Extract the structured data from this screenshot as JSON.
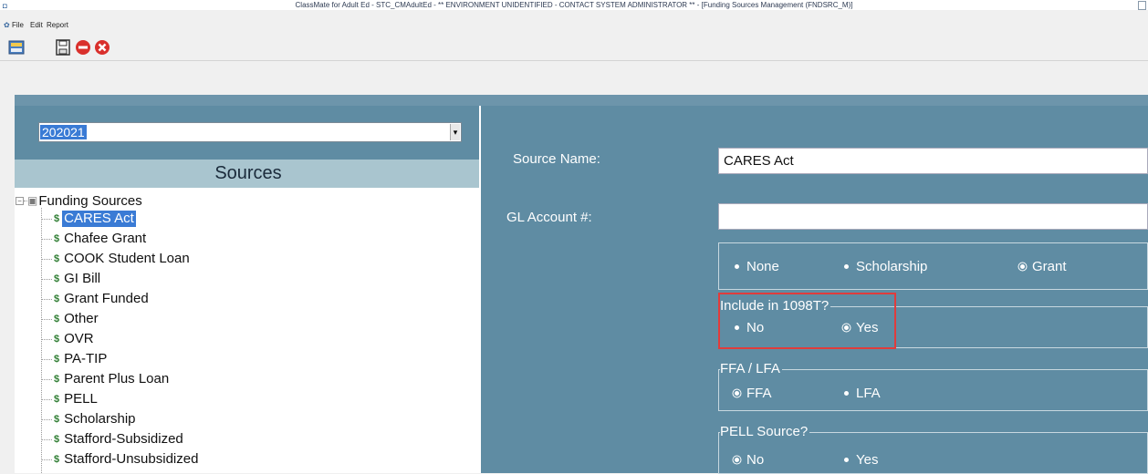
{
  "window": {
    "title": "ClassMate for Adult Ed - STC_CMAdultEd - ** ENVIRONMENT UNIDENTIFIED - CONTACT SYSTEM ADMINISTRATOR ** - [Funding Sources Management (FNDSRC_M)]"
  },
  "menu": {
    "items": [
      "File",
      "Edit",
      "Report"
    ]
  },
  "toolbar": {
    "buttons": [
      {
        "name": "refresh-icon"
      },
      {
        "name": "save-icon"
      },
      {
        "name": "delete-icon"
      },
      {
        "name": "close-icon"
      }
    ]
  },
  "left": {
    "year_value": "202021",
    "sources_header": "Sources",
    "tree": {
      "root": "Funding Sources",
      "items": [
        "CARES Act",
        "Chafee Grant",
        "COOK Student Loan",
        "GI Bill",
        "Grant Funded",
        "Other",
        "OVR",
        "PA-TIP",
        "Parent Plus Loan",
        "PELL",
        "Scholarship",
        "Stafford-Subsidized",
        "Stafford-Unsubsidized"
      ],
      "selected": "CARES Act"
    }
  },
  "form": {
    "source_name_label": "Source Name:",
    "source_name_value": "CARES Act",
    "gl_account_label": "GL Account #:",
    "gl_account_value": "",
    "type_options": [
      "None",
      "Scholarship",
      "Grant"
    ],
    "type_selected": "Grant",
    "include_1098t_label": "Include in 1098T?",
    "include_1098t_options": [
      "No",
      "Yes"
    ],
    "include_1098t_selected": "Yes",
    "ffa_lfa_label": "FFA / LFA",
    "ffa_lfa_options": [
      "FFA",
      "LFA"
    ],
    "ffa_lfa_selected": "FFA",
    "pell_label": "PELL Source?",
    "pell_options": [
      "No",
      "Yes"
    ],
    "pell_selected": "No"
  }
}
